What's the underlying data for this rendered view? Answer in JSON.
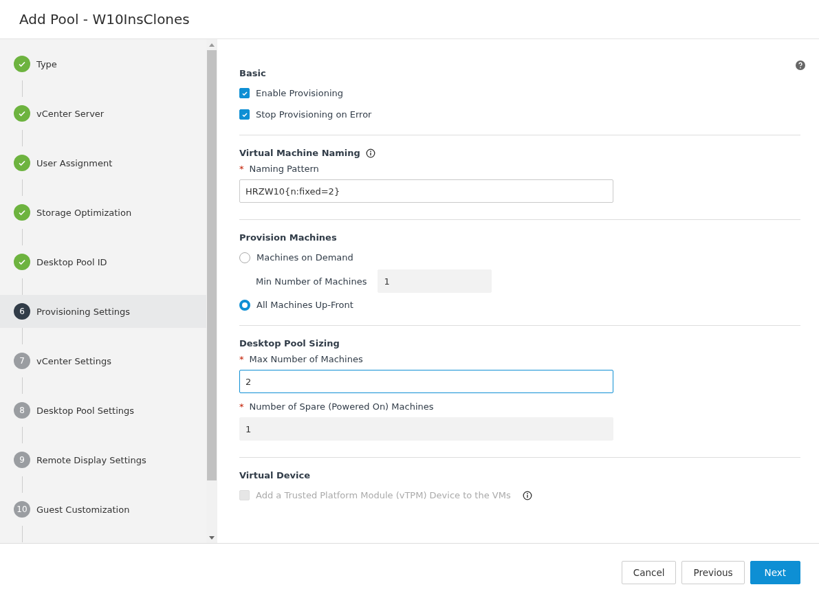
{
  "window": {
    "title": "Add Pool - W10InsClones"
  },
  "steps": [
    {
      "label": "Type",
      "kind": "done"
    },
    {
      "label": "vCenter Server",
      "kind": "done"
    },
    {
      "label": "User Assignment",
      "kind": "done"
    },
    {
      "label": "Storage Optimization",
      "kind": "done"
    },
    {
      "label": "Desktop Pool ID",
      "kind": "done"
    },
    {
      "marker": "6",
      "label": "Provisioning Settings",
      "kind": "current"
    },
    {
      "marker": "7",
      "label": "vCenter Settings",
      "kind": "pending"
    },
    {
      "marker": "8",
      "label": "Desktop Pool Settings",
      "kind": "pending"
    },
    {
      "marker": "9",
      "label": "Remote Display Settings",
      "kind": "pending"
    },
    {
      "marker": "10",
      "label": "Guest Customization",
      "kind": "pending"
    }
  ],
  "sections": [
    {
      "title": "Basic",
      "items": [
        {
          "kind": "checkbox",
          "label": "Enable Provisioning",
          "checked": true,
          "disabled": false
        },
        {
          "kind": "checkbox",
          "label": "Stop Provisioning on Error",
          "checked": true,
          "disabled": false
        }
      ]
    },
    {
      "title": "Virtual Machine Naming",
      "info": true,
      "items": [
        {
          "kind": "field",
          "required_mark": "*",
          "label": "Naming Pattern",
          "value": "HRZW10{n:fixed=2}",
          "focused": false,
          "readonly": false
        }
      ]
    },
    {
      "title": "Provision Machines",
      "items": [
        {
          "kind": "radio",
          "label": "Machines on Demand",
          "selected": false
        },
        {
          "kind": "inline-field",
          "label": "Min Number of Machines",
          "value": "1",
          "readonly": true
        },
        {
          "kind": "radio",
          "label": "All Machines Up-Front",
          "selected": true
        }
      ]
    },
    {
      "title": "Desktop Pool Sizing",
      "items": [
        {
          "kind": "field",
          "required_mark": "*",
          "label": "Max Number of Machines",
          "value": "2",
          "focused": true,
          "readonly": false
        },
        {
          "kind": "field",
          "required_mark": "*",
          "label": "Number of Spare (Powered On) Machines",
          "value": "1",
          "focused": false,
          "readonly": true
        }
      ]
    },
    {
      "title": "Virtual Device",
      "items": [
        {
          "kind": "checkbox",
          "label": "Add a Trusted Platform Module (vTPM) Device to the VMs",
          "checked": false,
          "disabled": true,
          "info": true
        }
      ]
    }
  ],
  "buttons": [
    {
      "label": "Cancel",
      "kind": "secondary"
    },
    {
      "label": "Previous",
      "kind": "secondary"
    },
    {
      "label": "Next",
      "kind": "primary"
    }
  ]
}
